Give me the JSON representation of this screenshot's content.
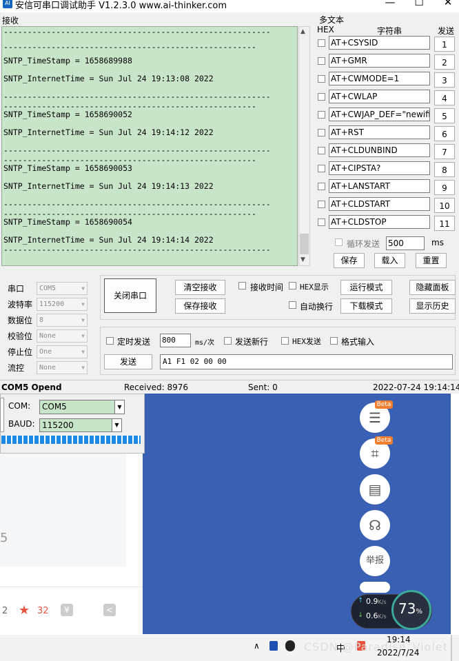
{
  "window": {
    "title": "安信可串口调试助手 V1.2.3.0     www.ai-thinker.com",
    "min": "—",
    "max": "☐",
    "close": "✕"
  },
  "receive": {
    "label": "接收",
    "lines": [
      "--------------------------------------------------------",
      "-----------------------------------------------------",
      "SNTP_TimeStamp = 1658689988",
      "SNTP_InternetTime = Sun Jul 24 19:13:08 2022",
      "--------------------------------------------------------",
      "-----------------------------------------------------",
      "SNTP_TimeStamp = 1658690052",
      "SNTP_InternetTime = Sun Jul 24 19:14:12 2022",
      "--------------------------------------------------------",
      "-----------------------------------------------------",
      "SNTP_TimeStamp = 1658690053",
      "SNTP_InternetTime = Sun Jul 24 19:14:13 2022",
      "--------------------------------------------------------",
      "-----------------------------------------------------",
      "SNTP_TimeStamp = 1658690054",
      "SNTP_InternetTime = Sun Jul 24 19:14:14 2022",
      "--------------------------------------------------------"
    ]
  },
  "multi": {
    "label": "多文本",
    "hex": "HEX",
    "str": "字符串",
    "send": "发送",
    "cmds": [
      "AT+CSYSID",
      "AT+GMR",
      "AT+CWMODE=1",
      "AT+CWLAP",
      "AT+CWJAP_DEF=\"newifi_",
      "AT+RST",
      "AT+CLDUNBIND",
      "AT+CIPSTA?",
      "AT+LANSTART",
      "AT+CLDSTART",
      "AT+CLDSTOP"
    ],
    "nums": [
      "1",
      "2",
      "3",
      "4",
      "5",
      "6",
      "7",
      "8",
      "9",
      "10",
      "11"
    ],
    "loop_label": "循环发送",
    "loop_value": "500",
    "ms": "ms",
    "save": "保存",
    "load": "载入",
    "reset": "重置"
  },
  "serial": {
    "port_label": "串口",
    "port": "COM5",
    "baud_label": "波特率",
    "baud": "115200",
    "data_label": "数据位",
    "data": "8",
    "parity_label": "校验位",
    "parity": "None",
    "stop_label": "停止位",
    "stop": "One",
    "flow_label": "流控",
    "flow": "None"
  },
  "controls": {
    "close_port": "关闭串口",
    "clear_recv": "清空接收",
    "save_recv": "保存接收",
    "recv_time": "接收时间",
    "hex_show": "HEX显示",
    "run_mode": "运行模式",
    "hide_panel": "隐藏面板",
    "auto_wrap": "自动换行",
    "download_mode": "下载模式",
    "show_history": "显示历史"
  },
  "send": {
    "timed": "定时发送",
    "interval": "800",
    "unit": "ms/次",
    "newline": "发送新行",
    "hex_send": "HEX发送",
    "format": "格式输入",
    "button": "发送",
    "text": "A1 F1 02 00 00"
  },
  "status": {
    "port": "COM5 Opend",
    "received": "Received: 8976",
    "sent": "Sent: 0",
    "time": "2022-07-24 19:14:14"
  },
  "flasher": {
    "com_label": "COM:",
    "com": "COM5",
    "baud_label": "BAUD:",
    "baud": "115200"
  },
  "page": {
    "count_a": "2",
    "count_b": "32",
    "fab_beta": "Beta",
    "report": "举报",
    "side_digit": "5"
  },
  "speed": {
    "up": "0.9",
    "down": "0.6",
    "unit": "K/s",
    "percent": "73",
    "pct_sign": "%"
  },
  "taskbar": {
    "time": "19:14",
    "date": "2022/7/24",
    "ime": "中",
    "watermark": "CSDN @Paradise_Violet"
  }
}
